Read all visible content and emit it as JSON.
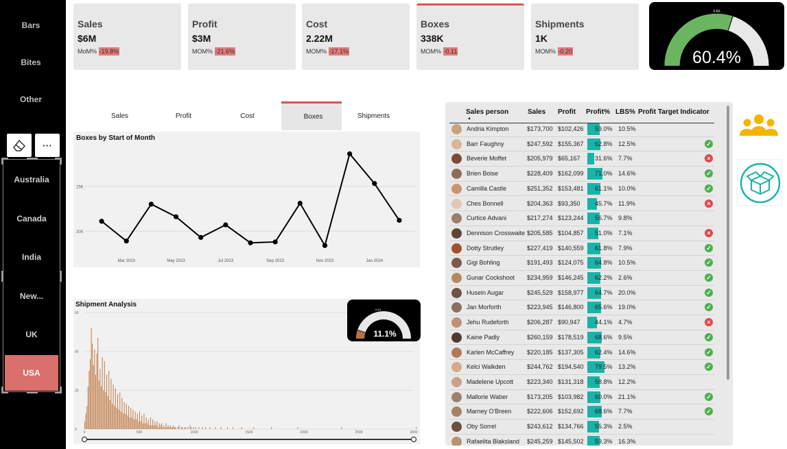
{
  "sidebar": {
    "top_items": [
      "Bars",
      "Bites",
      "Other"
    ],
    "tools": [
      {
        "icon": "eraser-icon"
      },
      {
        "icon": "more-options-icon",
        "glyph": "···"
      }
    ],
    "regions": [
      "Australia",
      "Canada",
      "India",
      "New...",
      "UK",
      "USA"
    ],
    "active_region": "USA"
  },
  "kpis": [
    {
      "title": "Sales",
      "value": "$6M",
      "mom_label": "MoM%",
      "mom": "-19.8%"
    },
    {
      "title": "Profit",
      "value": "$3M",
      "mom_label": "MOM%",
      "mom": "-21.6%"
    },
    {
      "title": "Cost",
      "value": "2.22M",
      "mom_label": "MOM%",
      "mom": "-17.1%"
    },
    {
      "title": "Boxes",
      "value": "338K",
      "mom_label": "MOM%",
      "mom": "-0.11"
    },
    {
      "title": "Shipments",
      "value": "1K",
      "mom_label": "MOM%",
      "mom": "-0.20"
    }
  ],
  "active_kpi": "Boxes",
  "gauge_main": {
    "value_text": "60.4%",
    "target_text": "0.60",
    "fraction": 0.604,
    "fill_color": "#6ab55f",
    "track_color": "#e8e8e8"
  },
  "tabs": [
    "Sales",
    "Profit",
    "Cost",
    "Boxes",
    "Shipments"
  ],
  "active_tab": "Boxes",
  "line_chart": {
    "title": "Boxes by Start of Month",
    "y_ticks": [
      "30K",
      "25K"
    ],
    "x_ticks": [
      "Mar 2023",
      "May 2023",
      "Jul 2023",
      "Sep 2023",
      "Nov 2023",
      "Jan 2024"
    ]
  },
  "shipment_panel": {
    "title": "Shipment Analysis",
    "y_ticks": [
      "60",
      "40",
      "20",
      "0"
    ],
    "x_ticks": [
      "0",
      "500",
      "1000",
      "1500",
      "2000",
      "2500",
      "3000"
    ]
  },
  "gauge_small": {
    "value_text": "11.1%",
    "target_text": "0.10",
    "fraction": 0.111,
    "fill_color": "#b87344",
    "track_color": "#e8e8e8"
  },
  "table": {
    "headers": [
      "Sales person",
      "Sales",
      "Profit",
      "Profit%",
      "LBS%",
      "Profit Target Indicator"
    ],
    "rows": [
      {
        "name": "Andria Kimpton",
        "sales": "$173,700",
        "profit": "$102,426",
        "pct": "59.0%",
        "lbs": "10.5%",
        "ind": "",
        "avatar": "#c9a27e"
      },
      {
        "name": "Barr Faughny",
        "sales": "$247,592",
        "profit": "$155,367",
        "pct": "62.8%",
        "lbs": "12.5%",
        "ind": "ok",
        "avatar": "#d8b59a"
      },
      {
        "name": "Beverie Moffet",
        "sales": "$205,979",
        "profit": "$65,167",
        "pct": "31.6%",
        "lbs": "7.7%",
        "ind": "bad",
        "avatar": "#7b4a3a"
      },
      {
        "name": "Brien Boise",
        "sales": "$228,409",
        "profit": "$162,099",
        "pct": "71.0%",
        "lbs": "14.6%",
        "ind": "ok",
        "avatar": "#8b6d5a"
      },
      {
        "name": "Camilla Castle",
        "sales": "$251,352",
        "profit": "$153,481",
        "pct": "61.1%",
        "lbs": "10.0%",
        "ind": "ok",
        "avatar": "#c99570"
      },
      {
        "name": "Ches Bonnell",
        "sales": "$204,363",
        "profit": "$93,350",
        "pct": "45.7%",
        "lbs": "11.9%",
        "ind": "bad",
        "avatar": "#e2c6b5"
      },
      {
        "name": "Curtice Advani",
        "sales": "$217,274",
        "profit": "$123,244",
        "pct": "56.7%",
        "lbs": "9.8%",
        "ind": "",
        "avatar": "#9c7e6a"
      },
      {
        "name": "Dennison Crosswaite",
        "sales": "$205,585",
        "profit": "$104,857",
        "pct": "51.0%",
        "lbs": "7.1%",
        "ind": "bad",
        "avatar": "#5e4538"
      },
      {
        "name": "Dotty Strutley",
        "sales": "$227,419",
        "profit": "$140,559",
        "pct": "61.8%",
        "lbs": "7.9%",
        "ind": "ok",
        "avatar": "#a0522d"
      },
      {
        "name": "Gigi Bohling",
        "sales": "$191,493",
        "profit": "$124,075",
        "pct": "64.8%",
        "lbs": "10.5%",
        "ind": "ok",
        "avatar": "#7a5c48"
      },
      {
        "name": "Gunar Cockshoot",
        "sales": "$234,959",
        "profit": "$146,245",
        "pct": "62.2%",
        "lbs": "2.6%",
        "ind": "ok",
        "avatar": "#b58a62"
      },
      {
        "name": "Husein Augar",
        "sales": "$245,529",
        "profit": "$158,977",
        "pct": "64.7%",
        "lbs": "20.0%",
        "ind": "ok",
        "avatar": "#6d5646"
      },
      {
        "name": "Jan Morforth",
        "sales": "$223,945",
        "profit": "$146,800",
        "pct": "65.6%",
        "lbs": "19.0%",
        "ind": "ok",
        "avatar": "#8a7060"
      },
      {
        "name": "Jehu Rudeforth",
        "sales": "$206,287",
        "profit": "$90,947",
        "pct": "44.1%",
        "lbs": "4.7%",
        "ind": "bad",
        "avatar": "#c08f78"
      },
      {
        "name": "Kaine Padly",
        "sales": "$260,159",
        "profit": "$178,519",
        "pct": "68.6%",
        "lbs": "9.5%",
        "ind": "ok",
        "avatar": "#4e3a30"
      },
      {
        "name": "Karlen McCaffrey",
        "sales": "$220,185",
        "profit": "$137,305",
        "pct": "62.4%",
        "lbs": "14.6%",
        "ind": "ok",
        "avatar": "#b07a58"
      },
      {
        "name": "Kelci Walkden",
        "sales": "$244,762",
        "profit": "$194,540",
        "pct": "79.5%",
        "lbs": "13.2%",
        "ind": "ok",
        "avatar": "#d4a98a"
      },
      {
        "name": "Madelene Upcott",
        "sales": "$223,340",
        "profit": "$131,318",
        "pct": "58.8%",
        "lbs": "12.2%",
        "ind": "",
        "avatar": "#caa287"
      },
      {
        "name": "Mallorie Waber",
        "sales": "$173,205",
        "profit": "$103,982",
        "pct": "60.0%",
        "lbs": "21.1%",
        "ind": "ok",
        "avatar": "#9d8070"
      },
      {
        "name": "Marney O'Breen",
        "sales": "$222,606",
        "profit": "$152,692",
        "pct": "68.6%",
        "lbs": "7.7%",
        "ind": "ok",
        "avatar": "#a3826a"
      },
      {
        "name": "Oby Sorrel",
        "sales": "$243,612",
        "profit": "$134,766",
        "pct": "55.3%",
        "lbs": "2.5%",
        "ind": "",
        "avatar": "#6a5040"
      },
      {
        "name": "Rafaelita Blaksland",
        "sales": "$245,259",
        "profit": "$145,502",
        "pct": "59.3%",
        "lbs": "16.3%",
        "ind": "",
        "avatar": "#b8926e"
      }
    ]
  },
  "right_icons": [
    {
      "icon": "team-icon",
      "color": "#f5b400"
    },
    {
      "icon": "box-icon",
      "color": "#19b3a8"
    }
  ],
  "colors": {
    "accent_red": "#d9534f",
    "teal": "#19b3a8",
    "bar_brown": "#c07a45"
  },
  "chart_data": [
    {
      "type": "line",
      "title": "Boxes by Start of Month",
      "x": [
        "Feb 2023",
        "Mar 2023",
        "Apr 2023",
        "May 2023",
        "Jun 2023",
        "Jul 2023",
        "Aug 2023",
        "Sep 2023",
        "Oct 2023",
        "Nov 2023",
        "Dec 2023",
        "Jan 2024",
        "Feb 2024"
      ],
      "x_ticks": [
        "Mar 2023",
        "May 2023",
        "Jul 2023",
        "Sep 2023",
        "Nov 2023",
        "Jan 2024"
      ],
      "y": [
        26100,
        23900,
        28000,
        26600,
        24300,
        25700,
        23700,
        23800,
        28100,
        23400,
        33600,
        30300,
        26200
      ],
      "y_ticks": [
        25000,
        30000
      ],
      "ylim": [
        22500,
        35000
      ],
      "grid": true
    },
    {
      "type": "bar",
      "title": "Shipment Analysis",
      "x_range": [
        0,
        3000
      ],
      "x_ticks": [
        0,
        500,
        1000,
        1500,
        2000,
        2500,
        3000
      ],
      "y_ticks": [
        0,
        20,
        40,
        60
      ],
      "ylim": [
        0,
        60
      ],
      "bin_width": 10,
      "values": [
        4,
        8,
        12,
        22,
        30,
        36,
        52,
        44,
        33,
        41,
        28,
        39,
        47,
        25,
        31,
        22,
        37,
        20,
        35,
        19,
        28,
        17,
        30,
        15,
        26,
        13,
        23,
        12,
        21,
        11,
        18,
        10,
        19,
        9,
        16,
        8,
        14,
        8,
        13,
        7,
        12,
        6,
        11,
        6,
        10,
        5,
        9,
        5,
        8,
        4,
        9,
        4,
        7,
        3,
        8,
        3,
        6,
        3,
        5,
        2,
        6,
        2,
        5,
        2,
        4,
        2,
        4,
        1,
        3,
        2,
        3,
        1,
        2,
        1,
        3,
        1,
        2,
        1,
        2,
        1,
        1,
        2,
        1,
        1,
        0,
        1,
        2,
        0,
        1,
        1,
        0,
        1,
        1,
        0,
        1,
        0,
        2,
        1,
        0,
        1,
        0,
        1,
        0,
        0,
        1,
        0,
        0,
        1,
        0,
        0,
        1,
        0,
        0,
        0,
        1,
        0,
        0,
        0,
        0,
        1,
        0,
        0,
        0,
        0,
        1,
        0,
        0,
        0,
        0,
        0,
        1,
        0,
        0,
        0,
        0,
        1,
        0,
        0,
        0,
        0,
        0,
        0,
        0,
        1,
        0,
        0,
        0,
        0,
        0,
        0,
        0,
        0,
        0,
        0,
        1,
        0,
        0,
        0,
        0,
        0,
        0,
        0,
        0,
        0,
        0,
        0,
        0,
        0,
        0,
        0,
        1,
        0,
        0,
        0,
        0,
        0,
        0,
        0,
        0,
        0,
        0,
        0,
        0,
        0,
        0,
        0,
        0,
        0,
        0,
        0,
        0,
        0,
        0,
        0,
        1,
        0,
        0,
        0,
        0,
        0,
        0,
        0,
        0,
        0,
        0,
        0,
        0,
        0,
        0,
        0,
        0,
        0,
        0,
        0,
        0,
        0,
        0,
        0,
        0,
        0,
        0,
        0,
        0,
        0,
        0,
        0,
        0,
        0,
        0,
        0,
        0,
        0,
        0,
        0,
        1,
        0,
        0,
        0,
        0,
        0,
        0,
        0,
        0,
        0,
        0,
        0,
        0,
        0,
        0,
        0,
        0,
        0,
        0,
        0,
        0,
        0,
        0,
        0,
        0,
        0,
        0,
        0,
        0,
        0,
        0,
        0,
        0,
        0,
        0,
        0,
        0,
        0,
        0,
        0,
        0,
        0,
        0,
        0,
        0,
        0,
        0,
        0,
        0,
        0,
        0,
        0,
        0,
        0,
        0,
        0,
        0,
        0,
        0,
        0,
        0,
        0,
        0,
        0,
        0,
        0,
        0,
        0,
        1,
        0,
        0,
        0,
        0,
        0,
        0,
        0,
        0,
        0,
        0,
        0,
        0,
        0,
        0,
        0,
        1
      ],
      "grid": true
    }
  ]
}
